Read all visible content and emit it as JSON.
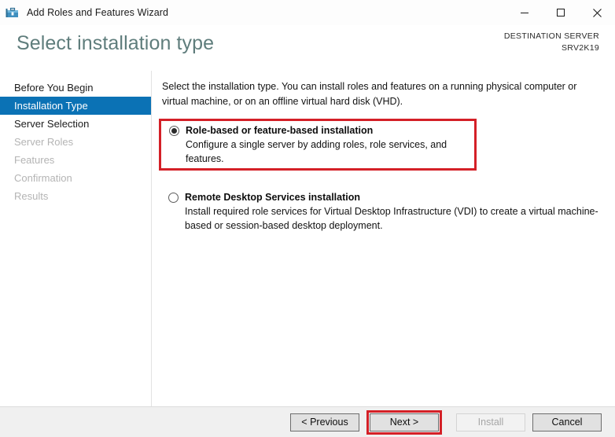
{
  "window": {
    "title": "Add Roles and Features Wizard",
    "icon": "wizard-toolbox-icon",
    "controls": {
      "minimize": "minimize-icon",
      "maximize": "maximize-icon",
      "close": "close-icon"
    }
  },
  "header": {
    "page_title": "Select installation type",
    "destination_label": "DESTINATION SERVER",
    "destination_value": "SRV2K19"
  },
  "sidebar": {
    "items": [
      {
        "label": "Before You Begin",
        "state": "enabled"
      },
      {
        "label": "Installation Type",
        "state": "active"
      },
      {
        "label": "Server Selection",
        "state": "enabled"
      },
      {
        "label": "Server Roles",
        "state": "disabled"
      },
      {
        "label": "Features",
        "state": "disabled"
      },
      {
        "label": "Confirmation",
        "state": "disabled"
      },
      {
        "label": "Results",
        "state": "disabled"
      }
    ]
  },
  "main": {
    "intro": "Select the installation type. You can install roles and features on a running physical computer or virtual machine, or on an offline virtual hard disk (VHD).",
    "options": [
      {
        "label": "Role-based or feature-based installation",
        "description": "Configure a single server by adding roles, role services, and features.",
        "selected": true,
        "highlighted": true
      },
      {
        "label": "Remote Desktop Services installation",
        "description": "Install required role services for Virtual Desktop Infrastructure (VDI) to create a virtual machine-based or session-based desktop deployment.",
        "selected": false,
        "highlighted": false
      }
    ]
  },
  "footer": {
    "previous_label": "< Previous",
    "next_label": "Next >",
    "install_label": "Install",
    "cancel_label": "Cancel",
    "install_enabled": false,
    "next_highlighted": true
  },
  "colors": {
    "accent_blue": "#0b72b5",
    "highlight_red": "#d42027",
    "title_teal": "#5f7d7c",
    "footer_bg": "#f0f0f0"
  }
}
